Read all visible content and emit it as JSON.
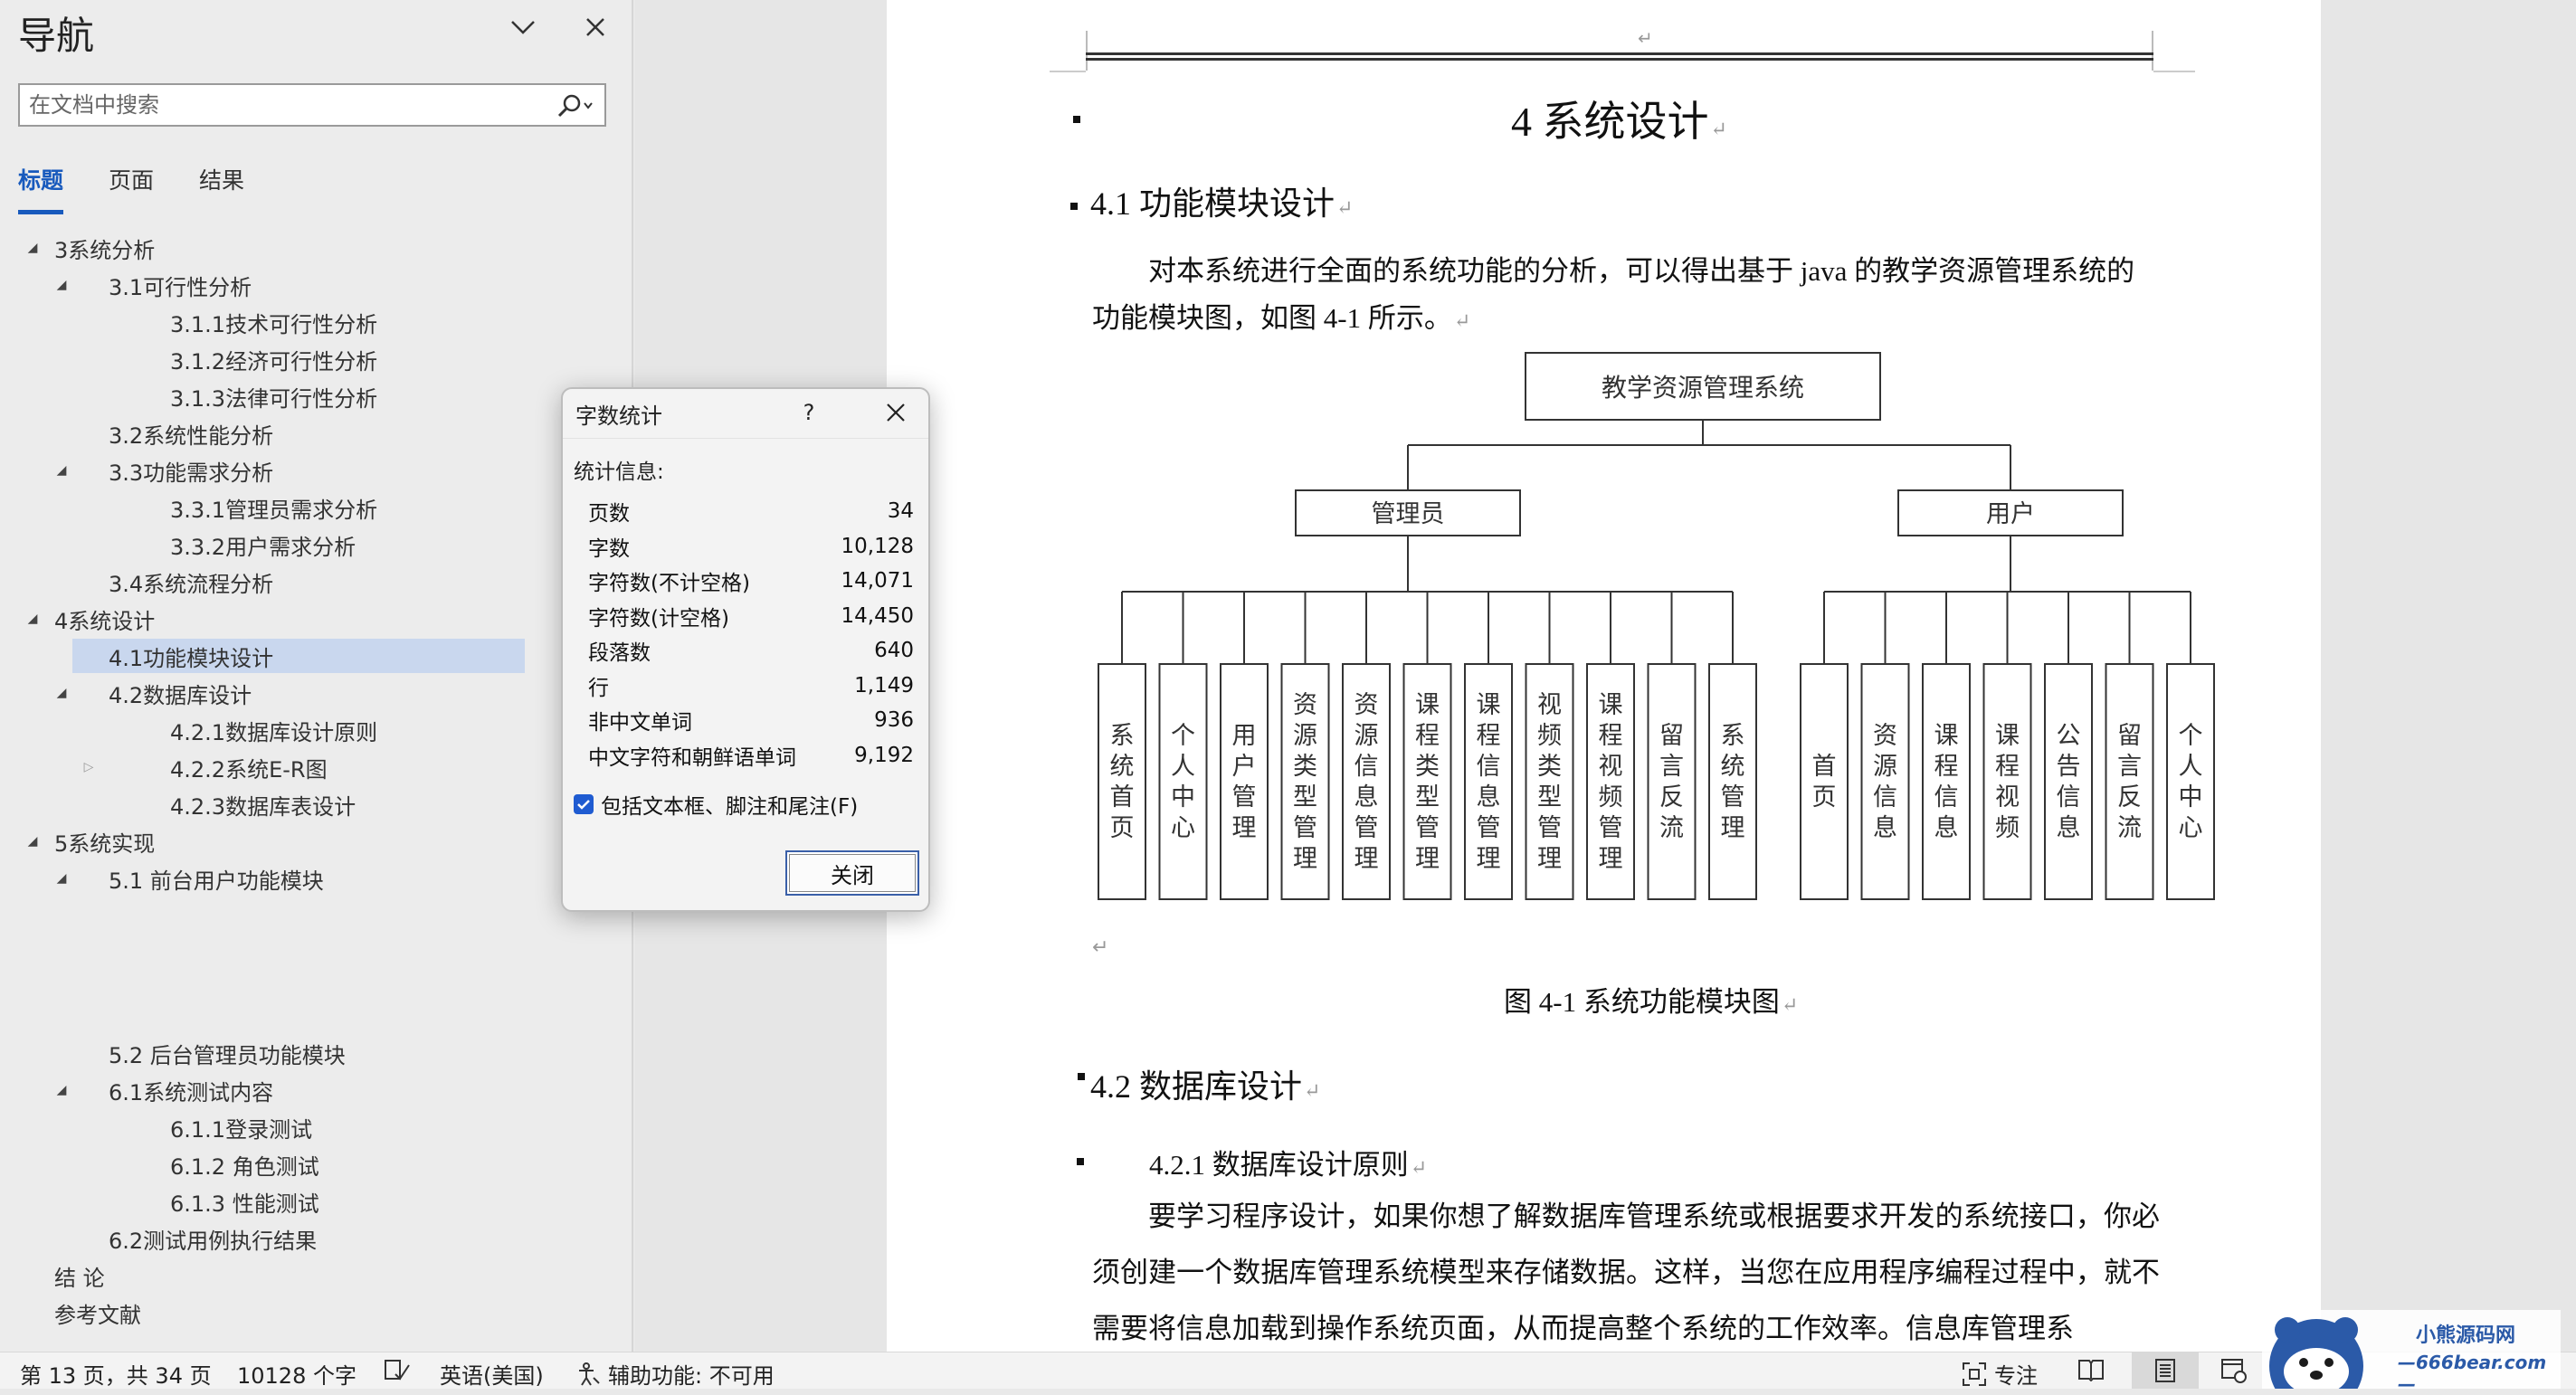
{
  "nav": {
    "title": "导航",
    "search_placeholder": "在文档中搜索",
    "tabs": [
      {
        "label": "标题",
        "active": true
      },
      {
        "label": "页面",
        "active": false
      },
      {
        "label": "结果",
        "active": false
      }
    ],
    "tree": [
      {
        "label": "3系统分析",
        "level": 0,
        "toggle": "expanded"
      },
      {
        "label": "3.1可行性分析",
        "level": 1,
        "toggle": "expanded"
      },
      {
        "label": "3.1.1技术可行性分析",
        "level": 2,
        "toggle": "none"
      },
      {
        "label": "3.1.2经济可行性分析",
        "level": 2,
        "toggle": "none"
      },
      {
        "label": "3.1.3法律可行性分析",
        "level": 2,
        "toggle": "none"
      },
      {
        "label": "3.2系统性能分析",
        "level": 1,
        "toggle": "none"
      },
      {
        "label": "3.3功能需求分析",
        "level": 1,
        "toggle": "expanded"
      },
      {
        "label": "3.3.1管理员需求分析",
        "level": 2,
        "toggle": "none"
      },
      {
        "label": "3.3.2用户需求分析",
        "level": 2,
        "toggle": "none"
      },
      {
        "label": "3.4系统流程分析",
        "level": 1,
        "toggle": "none"
      },
      {
        "label": "4系统设计",
        "level": 0,
        "toggle": "expanded"
      },
      {
        "label": "4.1功能模块设计",
        "level": 1,
        "toggle": "none",
        "selected": true
      },
      {
        "label": "4.2数据库设计",
        "level": 1,
        "toggle": "expanded"
      },
      {
        "label": "4.2.1数据库设计原则",
        "level": 2,
        "toggle": "none"
      },
      {
        "label": "4.2.2系统E-R图",
        "level": 2,
        "toggle": "collapsed"
      },
      {
        "label": "4.2.3数据库表设计",
        "level": 2,
        "toggle": "none"
      },
      {
        "label": "5系统实现",
        "level": 0,
        "toggle": "expanded"
      },
      {
        "label": "5.1 前台用户功能模块",
        "level": 1,
        "toggle": "expanded"
      },
      {
        "label": "5.2  后台管理员功能模块",
        "level": 1,
        "toggle": "none",
        "gap_before": 4
      },
      {
        "label": "6.1系统测试内容",
        "level": 1,
        "toggle": "expanded"
      },
      {
        "label": "6.1.1登录测试",
        "level": 2,
        "toggle": "none"
      },
      {
        "label": "6.1.2 角色测试",
        "level": 2,
        "toggle": "none"
      },
      {
        "label": "6.1.3 性能测试",
        "level": 2,
        "toggle": "none"
      },
      {
        "label": "6.2测试用例执行结果",
        "level": 1,
        "toggle": "none"
      },
      {
        "label": "结  论",
        "level": 0,
        "toggle": "none"
      },
      {
        "label": "参考文献",
        "level": 0,
        "toggle": "none"
      }
    ]
  },
  "doc": {
    "h1": "4 系统设计",
    "h2a": "4.1 功能模块设计",
    "p1": "对本系统进行全面的系统功能的分析，可以得出基于 java 的教学资源管理系统的功能模块图，如图 4-1 所示。",
    "diagram": {
      "root": "教学资源管理系统",
      "groups": [
        {
          "label": "管理员",
          "children": [
            "系统首页",
            "个人中心",
            "用户管理",
            "资源类型管理",
            "资源信息管理",
            "课程类型管理",
            "课程信息管理",
            "视频类型管理",
            "课程视频管理",
            "留言反流",
            "系统管理"
          ]
        },
        {
          "label": "用户",
          "children": [
            "首页",
            "资源信息",
            "课程信息",
            "课程视频",
            "公告信息",
            "留言反流",
            "个人中心"
          ]
        }
      ]
    },
    "caption": "图 4-1  系统功能模块图",
    "h2b": "4.2 数据库设计",
    "h3": "4.2.1 数据库设计原则",
    "p2": "要学习程序设计，如果你想了解数据库管理系统或根据要求开发的系统接口，你必须创建一个数据库管理系统模型来存储数据。这样，当您在应用程序编程过程中，就不需要将信息加载到操作系统页面，从而提高整个系统的工作效率。信息库管理系"
  },
  "dialog": {
    "title": "字数统计",
    "help": "?",
    "section": "统计信息:",
    "stats": [
      {
        "label": "页数",
        "value": "34"
      },
      {
        "label": "字数",
        "value": "10,128"
      },
      {
        "label": "字符数(不计空格)",
        "value": "14,071"
      },
      {
        "label": "字符数(计空格)",
        "value": "14,450"
      },
      {
        "label": "段落数",
        "value": "640"
      },
      {
        "label": "行",
        "value": "1,149"
      },
      {
        "label": "非中文单词",
        "value": "936"
      },
      {
        "label": "中文字符和朝鲜语单词",
        "value": "9,192"
      }
    ],
    "checkbox_label": "包括文本框、脚注和尾注(F)",
    "checkbox_checked": true,
    "close_button": "关闭"
  },
  "status": {
    "page": "第 13 页，共 34 页",
    "words": "10128 个字",
    "language": "英语(美国)",
    "accessibility": "辅助功能: 不可用",
    "focus": "专注"
  },
  "watermark": {
    "brand": "小熊源码网",
    "site": "—666bear.com—"
  },
  "colors": {
    "accent": "#185abd",
    "selected_bg": "#c9d7ee",
    "nav_bg": "#ececec"
  }
}
